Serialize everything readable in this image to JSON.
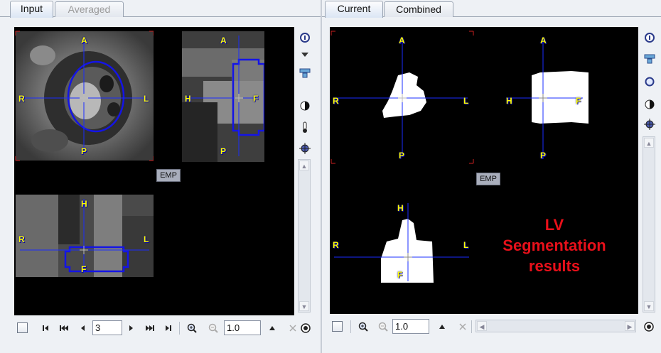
{
  "left": {
    "tabs": [
      {
        "label": "Input",
        "active": true
      },
      {
        "label": "Averaged",
        "active": false,
        "disabled": true
      }
    ],
    "views": {
      "transverse": {
        "top": "A",
        "bottom": "P",
        "left": "R",
        "right": "L"
      },
      "sagittal": {
        "top": "A",
        "bottom": "P",
        "left": "H",
        "right": "F"
      },
      "coronal": {
        "top": "H",
        "bottom": "F",
        "left": "R",
        "right": "L"
      }
    },
    "emp_label": "EMP",
    "side_tools": [
      "info-icon",
      "triangle-down-icon",
      "layout-icon",
      "contrast-icon",
      "thermometer-icon",
      "crosshair-icon"
    ],
    "bottom": {
      "slice_value": "3",
      "zoom_value": "1.0"
    }
  },
  "right": {
    "tabs": [
      {
        "label": "Current",
        "active": true
      },
      {
        "label": "Combined",
        "active": false
      }
    ],
    "views": {
      "transverse": {
        "top": "A",
        "bottom": "P",
        "left": "R",
        "right": "L"
      },
      "sagittal": {
        "top": "A",
        "bottom": "P",
        "left": "H",
        "right": "F"
      },
      "coronal": {
        "top": "H",
        "bottom": "F",
        "left": "R",
        "right": "L"
      }
    },
    "emp_label": "EMP",
    "annotation": [
      "LV",
      "Segmentation",
      "results"
    ],
    "side_tools": [
      "info-icon",
      "layout-icon",
      "circle-icon",
      "contrast-icon",
      "crosshair-icon"
    ],
    "bottom": {
      "zoom_value": "1.0"
    }
  },
  "colors": {
    "crosshair": "#1a2cff",
    "orientation_label": "#ffff00",
    "segmentation_text": "#e8101a",
    "roi_outline": "#1414e6"
  }
}
